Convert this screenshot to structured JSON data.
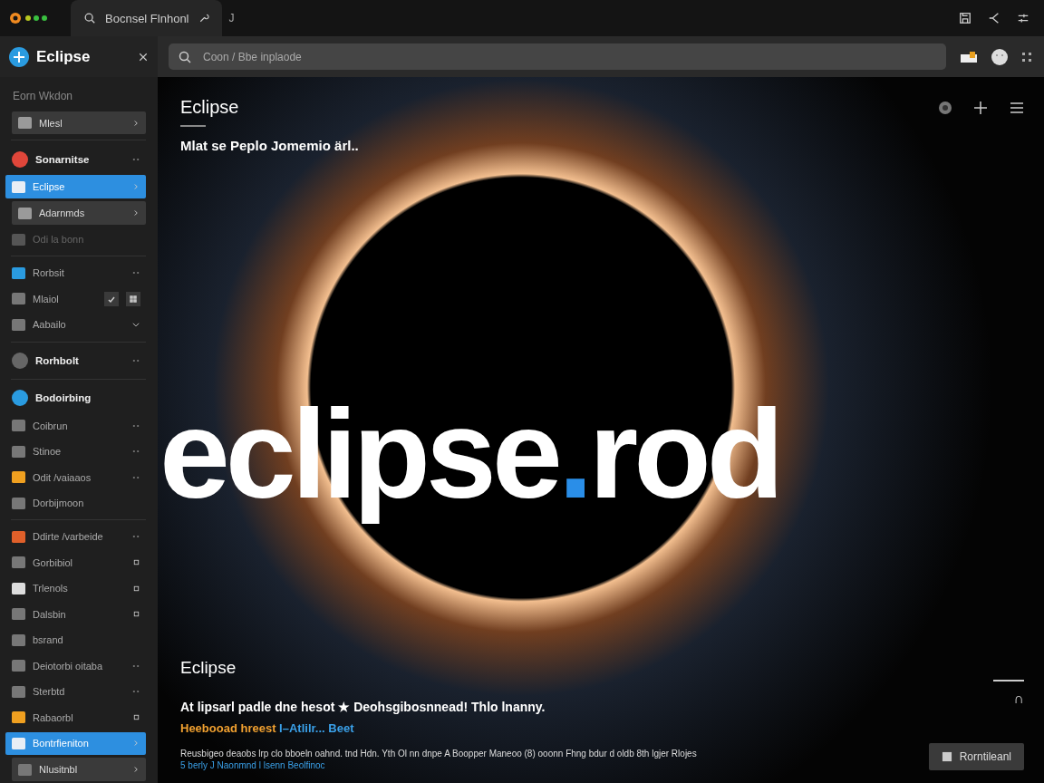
{
  "titlebar": {
    "tab": {
      "label": "Bocnsel  Flnhonl",
      "selected": true
    },
    "extra": "J"
  },
  "sidebar": {
    "title": "Eclipse",
    "section_label": "Eorn Wkdon",
    "items": [
      {
        "kind": "boxed",
        "label": "Mlesl",
        "trailing": {
          "kind": "chevron"
        },
        "selected": false,
        "color": "#9a9a9a",
        "divider_after": true
      },
      {
        "kind": "header",
        "label": "Sonarnitse",
        "trailing": {
          "kind": "dash"
        },
        "selected": false,
        "color": "#e0463a"
      },
      {
        "kind": "item",
        "label": "Eclipse",
        "trailing": {
          "kind": "chevron"
        },
        "selected": true,
        "color": "#e8eef5"
      },
      {
        "kind": "boxed",
        "label": "Adarnmds",
        "trailing": {
          "kind": "chevron"
        },
        "selected": false,
        "color": "#9a9a9a"
      },
      {
        "kind": "dim",
        "label": "Odi la bonn",
        "selected": false,
        "color": "#555555",
        "divider_after": true
      },
      {
        "kind": "item",
        "label": "Rorbsit",
        "trailing": {
          "kind": "dash"
        },
        "selected": false,
        "color": "#2a9be0"
      },
      {
        "kind": "item",
        "label": "Mlaiol",
        "trailing": {
          "kind": "pair"
        },
        "selected": false,
        "color": "#777777"
      },
      {
        "kind": "item",
        "label": "Aabailo",
        "trailing": {
          "kind": "caret"
        },
        "selected": false,
        "color": "#777777",
        "divider_after": true
      },
      {
        "kind": "header",
        "label": "Rorhbolt",
        "trailing": {
          "kind": "dash"
        },
        "selected": false,
        "color": "#666666",
        "divider_after": true
      },
      {
        "kind": "header",
        "label": "Bodoirbing",
        "selected": false,
        "color": "#2a9be0"
      },
      {
        "kind": "item",
        "label": "Coibrun",
        "trailing": {
          "kind": "dash"
        },
        "selected": false,
        "color": "#777777"
      },
      {
        "kind": "item",
        "label": "Stinoe",
        "trailing": {
          "kind": "dash"
        },
        "selected": false,
        "color": "#777777"
      },
      {
        "kind": "item",
        "label": "Odit /vaiaaos",
        "trailing": {
          "kind": "dash"
        },
        "selected": false,
        "color": "#f0a020"
      },
      {
        "kind": "item",
        "label": "Dorbijmoon",
        "selected": false,
        "color": "#777777",
        "divider_after": true
      },
      {
        "kind": "item",
        "label": "Ddirte /varbeide",
        "trailing": {
          "kind": "dash"
        },
        "selected": false,
        "color": "#e0602a"
      },
      {
        "kind": "item",
        "label": "Gorbibiol",
        "trailing": {
          "kind": "square"
        },
        "selected": false,
        "color": "#777777"
      },
      {
        "kind": "item",
        "label": "Trlenols",
        "trailing": {
          "kind": "square"
        },
        "selected": false,
        "color": "#dddddd"
      },
      {
        "kind": "item",
        "label": "Dalsbin",
        "trailing": {
          "kind": "square"
        },
        "selected": false,
        "color": "#777777"
      },
      {
        "kind": "item",
        "label": "bsrand",
        "selected": false,
        "color": "#777777"
      },
      {
        "kind": "item",
        "label": "Deiotorbi oitaba",
        "trailing": {
          "kind": "dash"
        },
        "selected": false,
        "color": "#777777"
      },
      {
        "kind": "item",
        "label": "Sterbtd",
        "trailing": {
          "kind": "dash"
        },
        "selected": false,
        "color": "#777777"
      },
      {
        "kind": "item",
        "label": "Rabaorbl",
        "trailing": {
          "kind": "square"
        },
        "selected": false,
        "color": "#f0a020"
      },
      {
        "kind": "item",
        "label": "Bontrfieniton",
        "trailing": {
          "kind": "chevron"
        },
        "selected": true,
        "color": "#e8eef5"
      },
      {
        "kind": "boxed",
        "label": "Nlusitnbl",
        "trailing": {
          "kind": "chevron"
        },
        "selected": false,
        "color": "#777777"
      }
    ]
  },
  "search": {
    "placeholder": "Coon / Bbe inplaode"
  },
  "main": {
    "title": "Eclipse",
    "subtitle": "Mlat se Peplo Jomemio ärl..",
    "wordmark": [
      "eclipse",
      ".",
      "rod"
    ],
    "caption_title": "Eclipse",
    "caption": "At lipsarl padle dne hesot ★ Deohsgibosnnead! Thlo lnanny.",
    "tagline": [
      "Heebooad hreest ",
      "I–Atlilr... Beet"
    ],
    "fine_print": [
      "Reusbigeo deaobs lrp clo bboeln oahnd.  tnd Hdn. Yth Ol nn dnpe  A Boopper Maneoo (8) ooonn Fhng bdur d oldb 8th lgjer Rlojes",
      "5 berly J Naonmnd l lsenn Beolfinoc"
    ],
    "button": "Rorntileanl",
    "scroll_mark": "∩"
  }
}
